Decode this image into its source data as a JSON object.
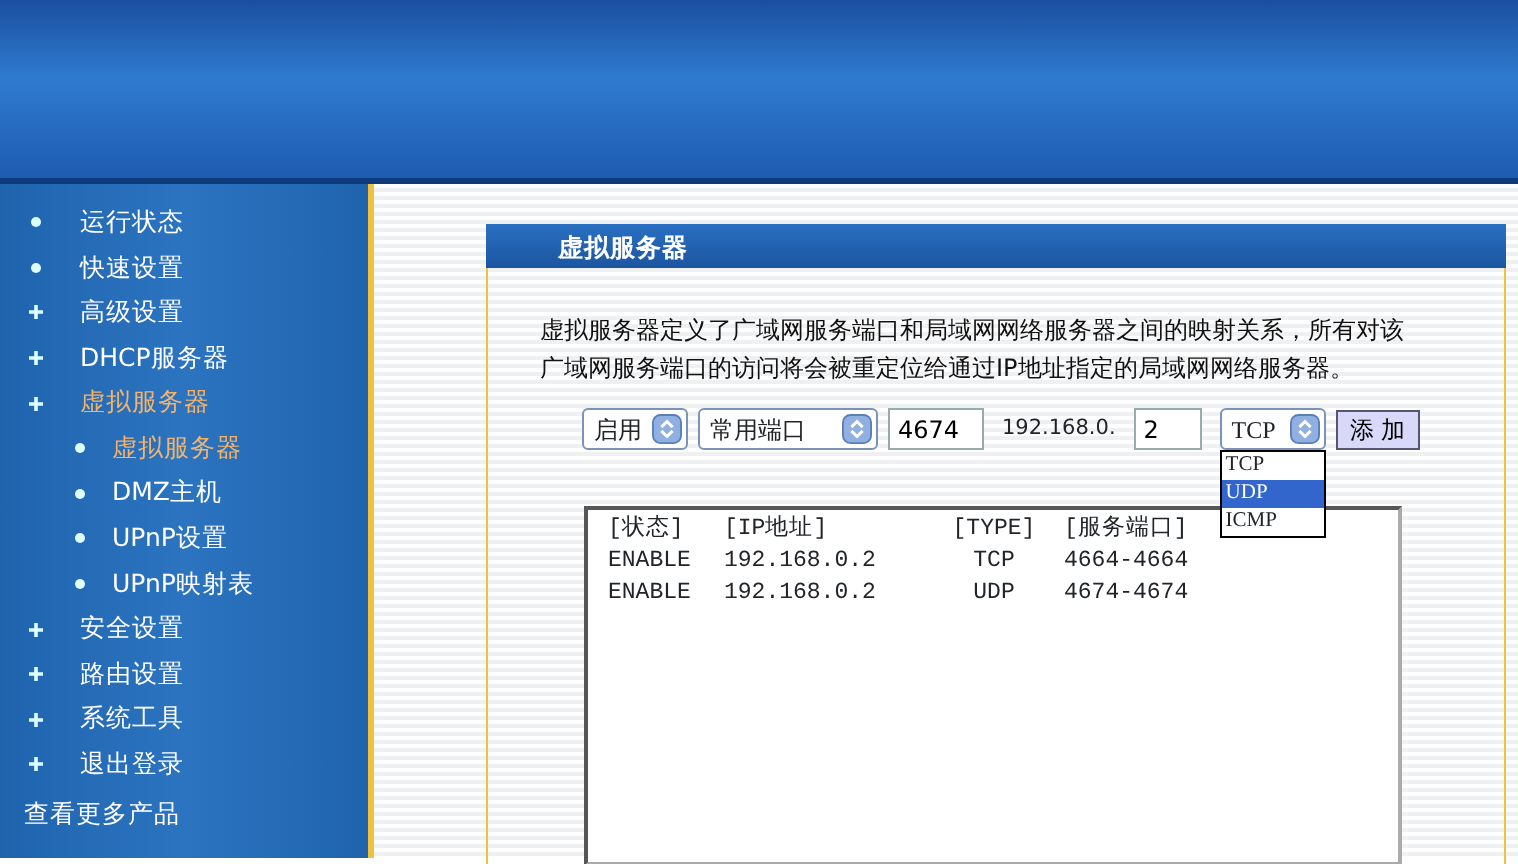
{
  "sidebar": {
    "items": [
      {
        "label": "运行状态",
        "kind": "dot",
        "selected": false
      },
      {
        "label": "快速设置",
        "kind": "dot",
        "selected": false
      },
      {
        "label": "高级设置",
        "kind": "plus",
        "selected": false
      },
      {
        "label": "DHCP服务器",
        "kind": "plus",
        "selected": false
      },
      {
        "label": "虚拟服务器",
        "kind": "plus",
        "selected": true,
        "children": [
          {
            "label": "虚拟服务器",
            "kind": "dot",
            "selected": true
          },
          {
            "label": "DMZ主机",
            "kind": "dot",
            "selected": false
          },
          {
            "label": "UPnP设置",
            "kind": "dot",
            "selected": false
          },
          {
            "label": "UPnP映射表",
            "kind": "dot",
            "selected": false
          }
        ]
      },
      {
        "label": "安全设置",
        "kind": "plus",
        "selected": false
      },
      {
        "label": "路由设置",
        "kind": "plus",
        "selected": false
      },
      {
        "label": "系统工具",
        "kind": "plus",
        "selected": false
      },
      {
        "label": "退出登录",
        "kind": "plus",
        "selected": false
      }
    ],
    "footer": "查看更多产品"
  },
  "panel": {
    "title": "虚拟服务器",
    "description": "虚拟服务器定义了广域网服务端口和局域网网络服务器之间的映射关系，所有对该广域网服务端口的访问将会被重定位给通过IP地址指定的局域网网络服务器。",
    "status_select": "启用",
    "port_select": "常用端口",
    "port_field": "4674",
    "ip_prefix": "192.168.0.",
    "ip_field": "2",
    "protocol_select": "TCP",
    "add_button": "添 加",
    "protocol_options": [
      {
        "label": "TCP",
        "selected": false
      },
      {
        "label": "UDP",
        "selected": true
      },
      {
        "label": "ICMP",
        "selected": false
      }
    ],
    "list": {
      "columns": [
        "[状态]",
        "[IP地址]",
        "[TYPE]",
        "[服务端口]"
      ],
      "rows": [
        [
          "ENABLE",
          "192.168.0.2",
          "TCP",
          "4664-4664"
        ],
        [
          "ENABLE",
          "192.168.0.2",
          "UDP",
          "4674-4674"
        ]
      ]
    }
  }
}
